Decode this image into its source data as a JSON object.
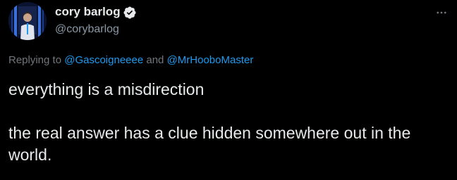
{
  "author": {
    "display_name": "cory barlog",
    "handle": "@corybarlog",
    "verified": true
  },
  "menu": {
    "more_icon": "more-horizontal-icon"
  },
  "reply_context": {
    "prefix": "Replying to ",
    "mention_1": "@Gascoigneeee",
    "joiner": " and ",
    "mention_2": "@MrHooboMaster"
  },
  "tweet": {
    "line_1": "everything is a misdirection",
    "line_2": "the real answer has a clue hidden somewhere out in the world."
  },
  "colors": {
    "background": "#000000",
    "text": "#e7e9ea",
    "secondary": "#71767b",
    "link": "#1d9bf0"
  }
}
